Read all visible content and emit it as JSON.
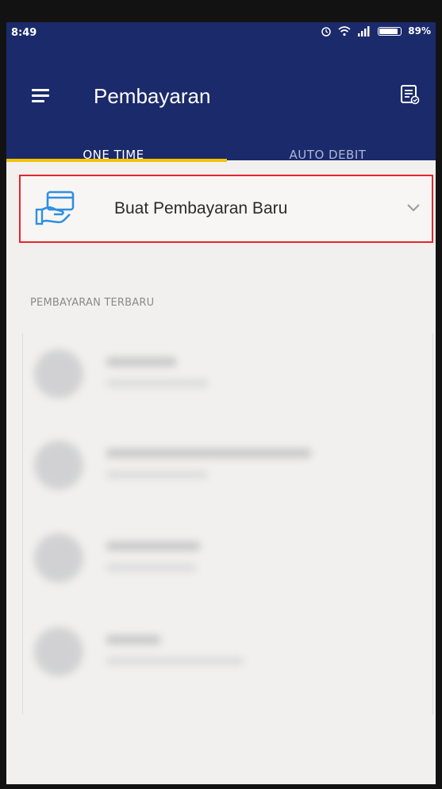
{
  "status_bar": {
    "time": "8:49",
    "battery_percent": "89%",
    "battery_level": 0.89
  },
  "app_bar": {
    "title": "Pembayaran",
    "menu_icon": "hamburger-menu-icon",
    "action_icon": "receipt-list-icon"
  },
  "tabs": [
    {
      "label": "ONE TIME",
      "selected": true
    },
    {
      "label": "AUTO DEBIT",
      "selected": false
    }
  ],
  "new_payment": {
    "label": "Buat Pembayaran Baru",
    "icon": "card-payment-icon",
    "expand_icon": "chevron-down-icon"
  },
  "recent_payments": {
    "title": "PEMBAYARAN TERBARU"
  },
  "colors": {
    "brand": "#1b2a6b",
    "tab_indicator": "#f2c200",
    "highlight_border": "#e5252c",
    "icon_blue": "#2f8fe0"
  }
}
